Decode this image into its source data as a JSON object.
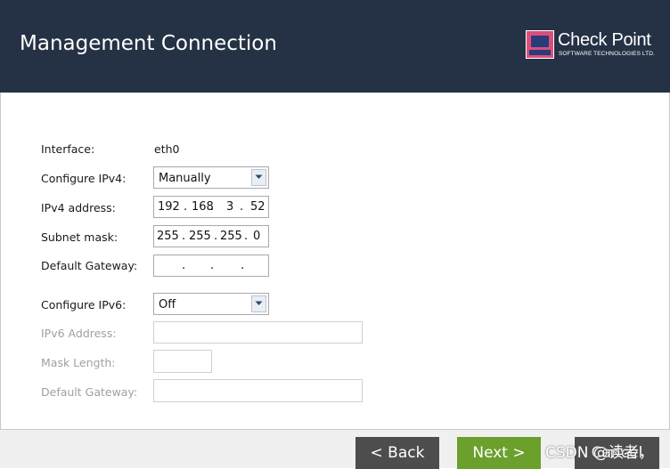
{
  "header": {
    "title": "Management Connection",
    "logo_text": "Check Point",
    "logo_sub": "SOFTWARE TECHNOLOGIES LTD."
  },
  "form": {
    "interface_label": "Interface:",
    "interface_value": "eth0",
    "configure_ipv4_label": "Configure IPv4:",
    "configure_ipv4_value": "Manually",
    "ipv4_address_label": "IPv4 address:",
    "ipv4_octets": [
      "192",
      "168",
      "3",
      "52"
    ],
    "subnet_mask_label": "Subnet mask:",
    "subnet_octets": [
      "255",
      "255",
      "255",
      "0"
    ],
    "default_gateway_label": "Default Gateway:",
    "gateway_octets": [
      "",
      "",
      "",
      ""
    ],
    "configure_ipv6_label": "Configure IPv6:",
    "configure_ipv6_value": "Off",
    "ipv6_address_label": "IPv6 Address:",
    "mask_length_label": "Mask Length:",
    "ipv6_gateway_label": "Default Gateway:"
  },
  "footer": {
    "back_label": "< Back",
    "next_label": "Next >",
    "cancel_label": "Cancel"
  },
  "watermark": "CSDN @读者，",
  "colors": {
    "header_bg": "#253245",
    "next_button": "#6aa02b",
    "dark_button": "#4d4d4d"
  }
}
